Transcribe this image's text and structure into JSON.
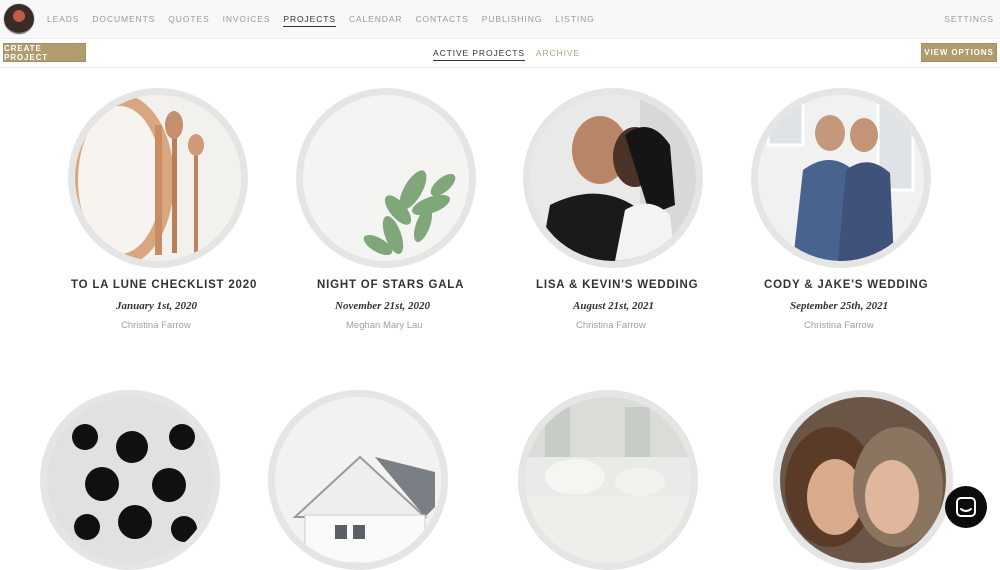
{
  "nav": {
    "links": [
      "LEADS",
      "DOCUMENTS",
      "QUOTES",
      "INVOICES",
      "PROJECTS",
      "CALENDAR",
      "CONTACTS",
      "PUBLISHING",
      "LISTING"
    ],
    "active": "PROJECTS",
    "settings": "SETTINGS"
  },
  "toolbar": {
    "create": "CREATE PROJECT",
    "view_options": "VIEW OPTIONS",
    "tabs": [
      "ACTIVE PROJECTS",
      "ARCHIVE"
    ]
  },
  "projects": [
    {
      "title": "TO LA LUNE CHECKLIST 2020",
      "date": "January 1st, 2020",
      "client": "Christina Farrow",
      "image": "table-setting-photo"
    },
    {
      "title": "NIGHT OF STARS GALA",
      "date": "November 21st, 2020",
      "client": "Meghan Mary Lau",
      "image": "succulent-plant-photo"
    },
    {
      "title": "LISA & KEVIN'S WEDDING",
      "date": "August 21st, 2021",
      "client": "Christina Farrow",
      "image": "couple-portrait-photo"
    },
    {
      "title": "CODY & JAKE'S WEDDING",
      "date": "September 25th, 2021",
      "client": "Christina Farrow",
      "image": "grooms-portrait-photo"
    },
    {
      "title": "",
      "date": "",
      "client": "",
      "image": "ornaments-photo"
    },
    {
      "title": "",
      "date": "",
      "client": "",
      "image": "barn-photo"
    },
    {
      "title": "",
      "date": "",
      "client": "",
      "image": "reception-table-photo"
    },
    {
      "title": "",
      "date": "",
      "client": "",
      "image": "couple-closeup-photo"
    }
  ],
  "colors": {
    "accent": "#b29b6c",
    "ring": "#e5e5e5"
  }
}
